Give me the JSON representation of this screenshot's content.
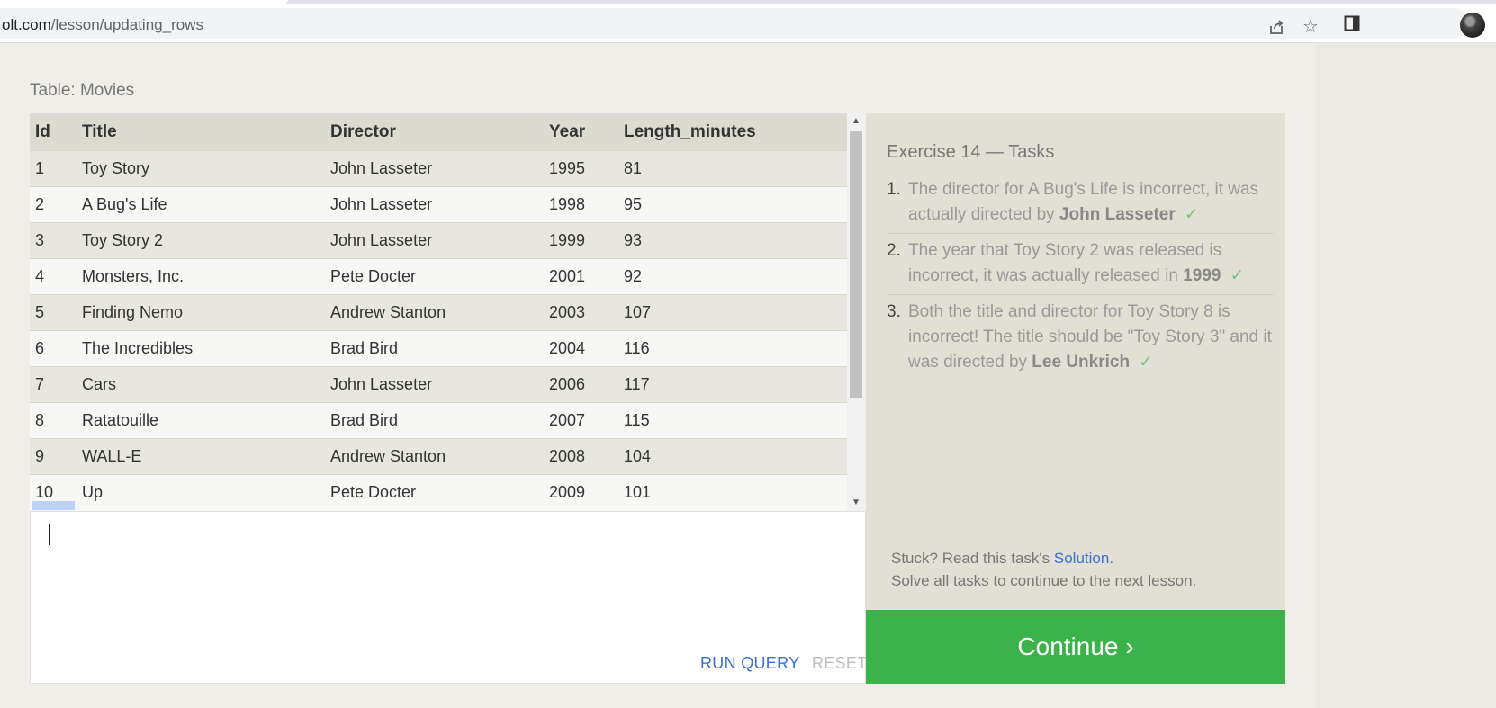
{
  "browser": {
    "url_host": "olt.com",
    "url_path": "/lesson/updating_rows"
  },
  "icons": {
    "share": "share-icon",
    "bookmark": "star-icon",
    "sidepanel": "side-panel-icon",
    "profile": "avatar"
  },
  "table": {
    "caption": "Table: Movies",
    "columns": [
      "Id",
      "Title",
      "Director",
      "Year",
      "Length_minutes"
    ],
    "rows": [
      [
        "1",
        "Toy Story",
        "John Lasseter",
        "1995",
        "81"
      ],
      [
        "2",
        "A Bug's Life",
        "John Lasseter",
        "1998",
        "95"
      ],
      [
        "3",
        "Toy Story 2",
        "John Lasseter",
        "1999",
        "93"
      ],
      [
        "4",
        "Monsters, Inc.",
        "Pete Docter",
        "2001",
        "92"
      ],
      [
        "5",
        "Finding Nemo",
        "Andrew Stanton",
        "2003",
        "107"
      ],
      [
        "6",
        "The Incredibles",
        "Brad Bird",
        "2004",
        "116"
      ],
      [
        "7",
        "Cars",
        "John Lasseter",
        "2006",
        "117"
      ],
      [
        "8",
        "Ratatouille",
        "Brad Bird",
        "2007",
        "115"
      ],
      [
        "9",
        "WALL-E",
        "Andrew Stanton",
        "2008",
        "104"
      ],
      [
        "10",
        "Up",
        "Pete Docter",
        "2009",
        "101"
      ]
    ]
  },
  "editor": {
    "run_label": "RUN QUERY",
    "reset_label": "RESET"
  },
  "tasks": {
    "title": "Exercise 14 — Tasks",
    "items": [
      {
        "num": "1.",
        "text": "The director for A Bug's Life is incorrect, it was actually directed by ",
        "bold": "John Lasseter",
        "check": "✓"
      },
      {
        "num": "2.",
        "text": "The year that Toy Story 2 was released is incorrect, it was actually released in ",
        "bold": "1999",
        "check": "✓"
      },
      {
        "num": "3.",
        "text": "Both the title and director for Toy Story 8 is incorrect! The title should be \"Toy Story 3\" and it was directed by ",
        "bold": "Lee Unkrich",
        "check": "✓"
      }
    ],
    "help_prefix": "Stuck? Read this task's ",
    "help_link": "Solution",
    "help_suffix": ".",
    "help_line2": "Solve all tasks to continue to the next lesson."
  },
  "continue_label": "Continue ›",
  "colors": {
    "accent_green": "#3bb34a",
    "link_blue": "#3b6fd6",
    "check_green": "#7ac47f"
  }
}
